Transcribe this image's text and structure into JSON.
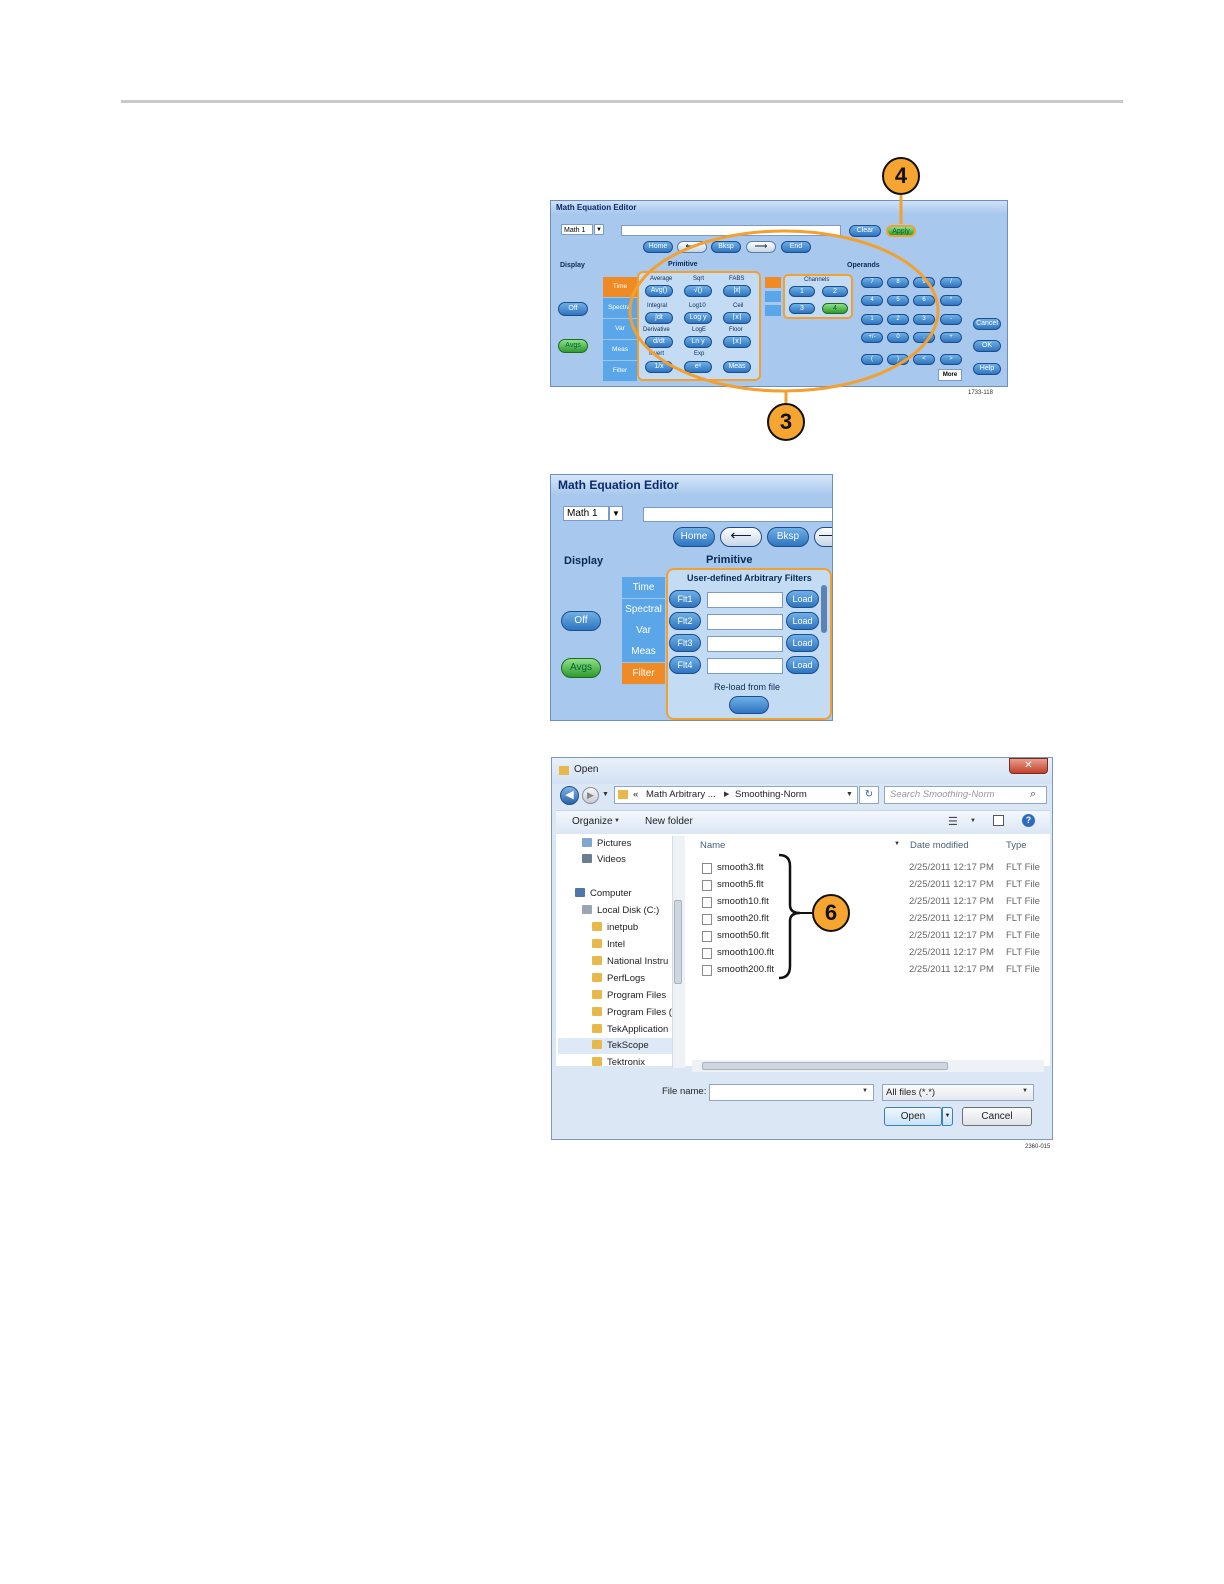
{
  "panel1": {
    "title": "Math Equation Editor",
    "math_select": "Math 1",
    "buttons": {
      "clear": "Clear",
      "apply": "Apply",
      "home": "Home",
      "bksp": "Bksp",
      "end": "End"
    },
    "labels": {
      "display": "Display",
      "primitive": "Primitive",
      "operands": "Operands",
      "channels": "Channels",
      "more": "More"
    },
    "display_buttons": [
      "Off",
      "Avgs"
    ],
    "tabs": [
      "Time",
      "Spectral",
      "Var",
      "Meas",
      "Filter"
    ],
    "primitive_labels": [
      "Average",
      "Sqrt",
      "FABS",
      "Integral",
      "Log10",
      "Ceil",
      "Derivative",
      "LogE",
      "Floor",
      "Invert",
      "Exp"
    ],
    "primitive_buttons": [
      "Avg()",
      "√()",
      "|x|",
      "∫dt",
      "Log y",
      "⌈x⌉",
      "d/dt",
      "Ln y",
      "⌊x⌋",
      "1/x",
      "eˣ",
      "Meas"
    ],
    "channels": [
      "1",
      "2",
      "3",
      "4"
    ],
    "keypad": [
      "7",
      "8",
      "9",
      "/",
      "4",
      "5",
      "6",
      "*",
      "1",
      "2",
      "3",
      "-",
      "+/-",
      "0",
      ".",
      "+",
      "(",
      ")",
      "<",
      ">"
    ],
    "right_buttons": [
      "Cancel",
      "OK",
      "Help"
    ],
    "figure_id": "1733-118"
  },
  "callouts": {
    "c4": "4",
    "c3": "3",
    "c6": "6"
  },
  "panel2": {
    "title": "Math Equation Editor",
    "math_select": "Math 1",
    "buttons": {
      "home": "Home",
      "bksp": "Bksp"
    },
    "labels": {
      "display": "Display",
      "primitive": "Primitive",
      "filters_title": "User-defined Arbitrary Filters",
      "reload": "Re-load from file"
    },
    "display_buttons": [
      "Off",
      "Avgs"
    ],
    "tabs": [
      "Time",
      "Spectral",
      "Var",
      "Meas",
      "Filter"
    ],
    "filters": [
      "Flt1",
      "Flt2",
      "Flt3",
      "Flt4"
    ],
    "load": "Load"
  },
  "panel3": {
    "title": "Open",
    "breadcrumb": [
      "«",
      "Math Arbitrary ...",
      "Smoothing-Norm"
    ],
    "search_placeholder": "Search Smoothing-Norm",
    "organize": "Organize",
    "new_folder": "New folder",
    "columns": {
      "name": "Name",
      "date": "Date modified",
      "type": "Type"
    },
    "tree": [
      "Pictures",
      "Videos",
      "Computer",
      "Local Disk (C:)",
      "inetpub",
      "Intel",
      "National Instru",
      "PerfLogs",
      "Program Files",
      "Program Files (",
      "TekApplication",
      "TekScope",
      "Tektronix"
    ],
    "files": [
      {
        "name": "smooth3.flt",
        "date": "2/25/2011 12:17 PM",
        "type": "FLT File"
      },
      {
        "name": "smooth5.flt",
        "date": "2/25/2011 12:17 PM",
        "type": "FLT File"
      },
      {
        "name": "smooth10.flt",
        "date": "2/25/2011 12:17 PM",
        "type": "FLT File"
      },
      {
        "name": "smooth20.flt",
        "date": "2/25/2011 12:17 PM",
        "type": "FLT File"
      },
      {
        "name": "smooth50.flt",
        "date": "2/25/2011 12:17 PM",
        "type": "FLT File"
      },
      {
        "name": "smooth100.flt",
        "date": "2/25/2011 12:17 PM",
        "type": "FLT File"
      },
      {
        "name": "smooth200.flt",
        "date": "2/25/2011 12:17 PM",
        "type": "FLT File"
      }
    ],
    "file_name_label": "File name:",
    "file_type": "All files (*.*)",
    "open": "Open",
    "cancel": "Cancel",
    "figure_id": "2360-015"
  }
}
